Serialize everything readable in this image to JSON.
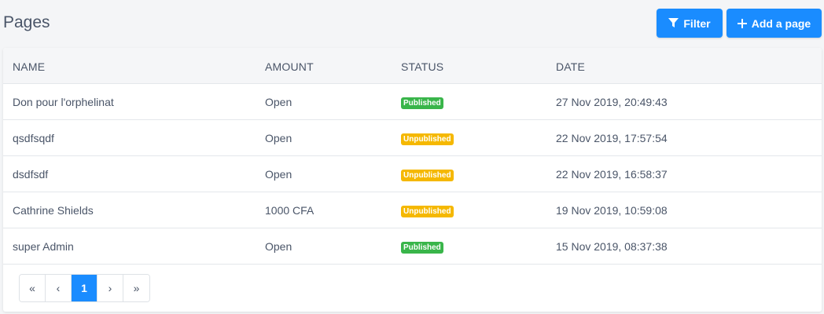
{
  "header": {
    "title": "Pages",
    "filter_label": "Filter",
    "add_label": "Add a page"
  },
  "table": {
    "columns": [
      "NAME",
      "AMOUNT",
      "STATUS",
      "DATE"
    ],
    "rows": [
      {
        "name": "Don pour l'orphelinat",
        "amount": "Open",
        "status": "Published",
        "date": "27 Nov 2019, 20:49:43"
      },
      {
        "name": "qsdfsqdf",
        "amount": "Open",
        "status": "Unpublished",
        "date": "22 Nov 2019, 17:57:54"
      },
      {
        "name": "dsdfsdf",
        "amount": "Open",
        "status": "Unpublished",
        "date": "22 Nov 2019, 16:58:37"
      },
      {
        "name": "Cathrine Shields",
        "amount": "1000 CFA",
        "status": "Unpublished",
        "date": "19 Nov 2019, 10:59:08"
      },
      {
        "name": "super Admin",
        "amount": "Open",
        "status": "Published",
        "date": "15 Nov 2019, 08:37:38"
      }
    ]
  },
  "pagination": {
    "first": "«",
    "prev": "‹",
    "current": "1",
    "next": "›",
    "last": "»"
  },
  "icons": {
    "filter": "filter-icon",
    "add": "plus-icon"
  },
  "colors": {
    "primary": "#1a8cff",
    "published": "#39b54a",
    "unpublished": "#f5b800"
  }
}
